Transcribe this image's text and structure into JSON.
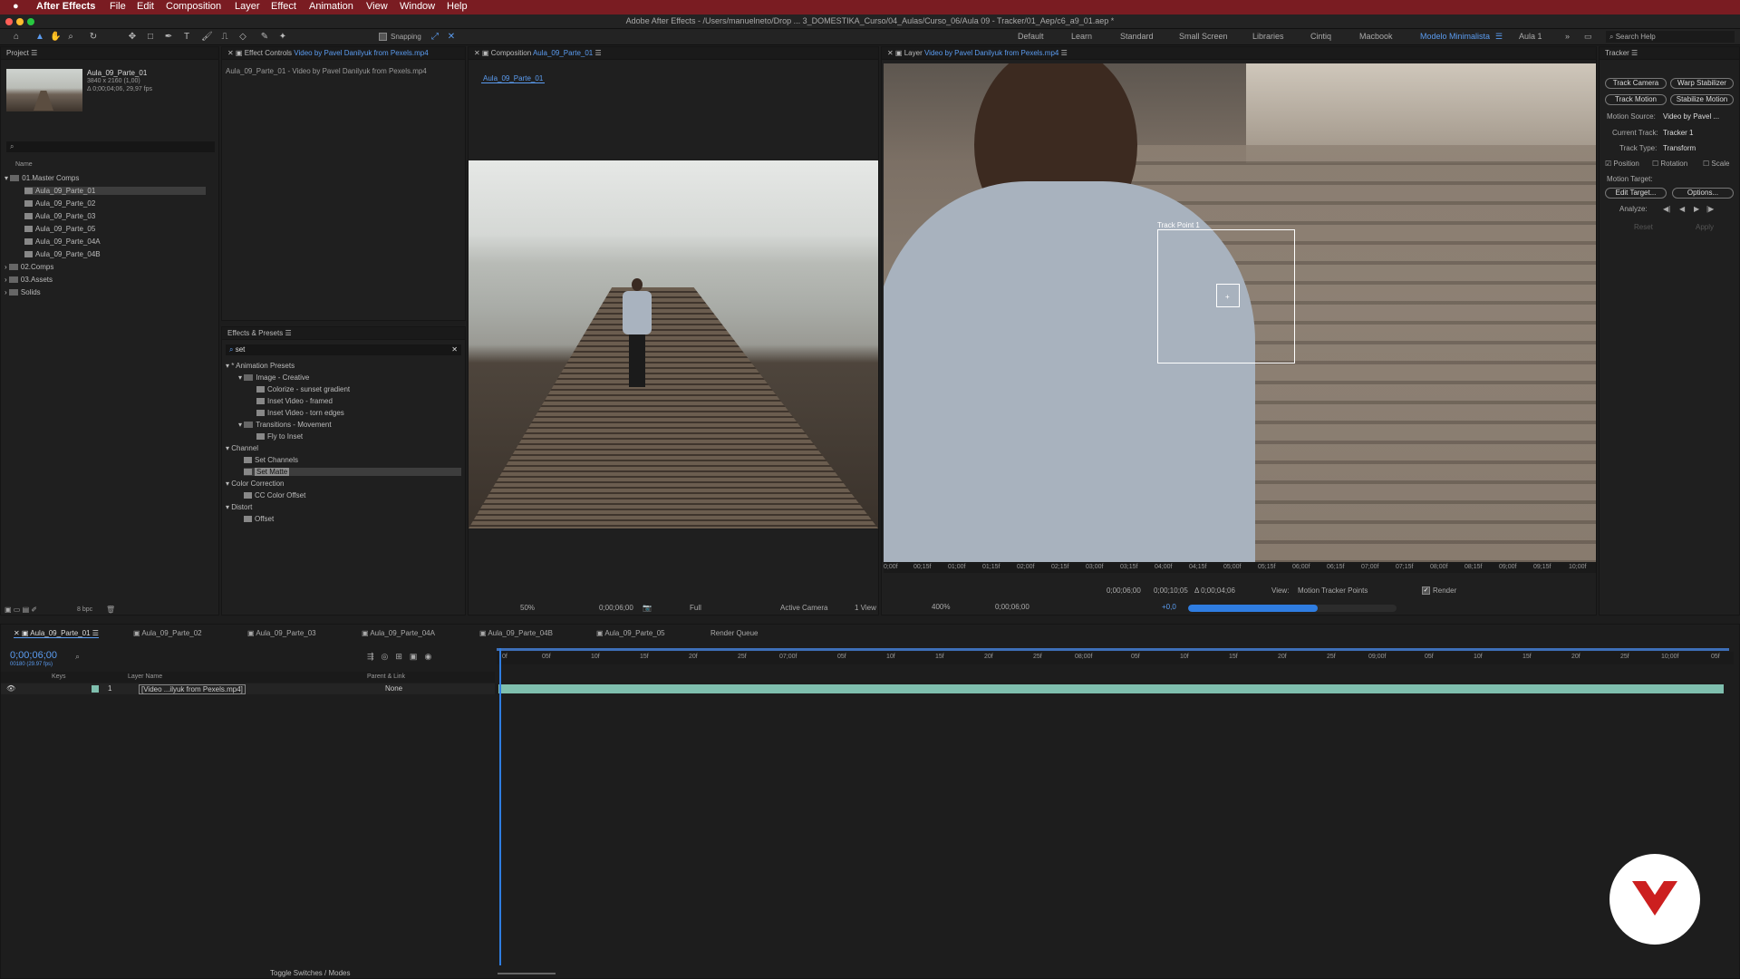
{
  "menu": {
    "app": "After Effects",
    "items": [
      "File",
      "Edit",
      "Composition",
      "Layer",
      "Effect",
      "Animation",
      "View",
      "Window",
      "Help"
    ]
  },
  "window_title": "Adobe After Effects - /Users/manuelneto/Drop ... 3_DOMESTIKA_Curso/04_Aulas/Curso_06/Aula 09 - Tracker/01_Aep/c6_a9_01.aep *",
  "toolbar": {
    "snapping_label": "Snapping",
    "workspaces": [
      "Default",
      "Learn",
      "Standard",
      "Small Screen",
      "Libraries",
      "Cintiq",
      "Macbook",
      "Modelo Minimalista",
      "Aula 1"
    ],
    "active_workspace": "Modelo Minimalista",
    "search_placeholder": "Search Help"
  },
  "project": {
    "tab": "Project",
    "thumb_name": "Aula_09_Parte_01",
    "thumb_size": "3840 x 2160 (1,00)",
    "thumb_duration": "Δ 0;00;04;06, 29,97 fps",
    "col_name": "Name",
    "items": [
      {
        "label": "01.Master Comps",
        "type": "folder",
        "open": true
      },
      {
        "label": "Aula_09_Parte_01",
        "type": "comp",
        "selected": true
      },
      {
        "label": "Aula_09_Parte_02",
        "type": "comp"
      },
      {
        "label": "Aula_09_Parte_03",
        "type": "comp"
      },
      {
        "label": "Aula_09_Parte_05",
        "type": "comp"
      },
      {
        "label": "Aula_09_Parte_04A",
        "type": "comp"
      },
      {
        "label": "Aula_09_Parte_04B",
        "type": "comp"
      },
      {
        "label": "02.Comps",
        "type": "folder"
      },
      {
        "label": "03.Assets",
        "type": "folder"
      },
      {
        "label": "Solids",
        "type": "folder"
      }
    ],
    "bpc": "8 bpc"
  },
  "effect_controls": {
    "tab_prefix": "Effect Controls",
    "tab_source": "Video by Pavel Danilyuk from Pexels.mp4",
    "subtitle": "Aula_09_Parte_01 - Video by Pavel Danilyuk from Pexels.mp4"
  },
  "effects_presets": {
    "tab": "Effects & Presets",
    "search_value": "set",
    "items": [
      {
        "label": "* Animation Presets",
        "level": 0
      },
      {
        "label": "Image - Creative",
        "level": 1
      },
      {
        "label": "Colorize - sunset gradient",
        "level": 2
      },
      {
        "label": "Inset Video - framed",
        "level": 2
      },
      {
        "label": "Inset Video - torn edges",
        "level": 2
      },
      {
        "label": "Transitions - Movement",
        "level": 1
      },
      {
        "label": "Fly to Inset",
        "level": 2
      },
      {
        "label": "Channel",
        "level": 0
      },
      {
        "label": "Set Channels",
        "level": 1
      },
      {
        "label": "Set Matte",
        "level": 1,
        "selected": true
      },
      {
        "label": "Color Correction",
        "level": 0
      },
      {
        "label": "CC Color Offset",
        "level": 1
      },
      {
        "label": "Distort",
        "level": 0
      },
      {
        "label": "Offset",
        "level": 1
      }
    ]
  },
  "composition": {
    "tab_prefix": "Composition",
    "tab_name": "Aula_09_Parte_01",
    "subtab": "Aula_09_Parte_01",
    "zoom": "50%",
    "timecode": "0;00;06;00",
    "resolution": "Full",
    "camera": "Active Camera",
    "views": "1 View"
  },
  "layer_viewer": {
    "tab_prefix": "Layer",
    "tab_source": "Video by Pavel Danilyuk from Pexels.mp4",
    "track_point_label": "Track Point 1",
    "ruler_ticks": [
      "0;00f",
      "00;15f",
      "01;00f",
      "01;15f",
      "02;00f",
      "02;15f",
      "03;00f",
      "03;15f",
      "04;00f",
      "04;15f",
      "05;00f",
      "05;15f",
      "06;00f",
      "06;15f",
      "07;00f",
      "07;15f",
      "08;00f",
      "08;15f",
      "09;00f",
      "09;15f",
      "10;00f"
    ],
    "in_time": "0;00;06;00",
    "out_time": "0;00;10;05",
    "duration": "Δ 0;00;04;06",
    "view_label": "View:",
    "view_value": "Motion Tracker Points",
    "render_label": "Render",
    "zoom": "400%",
    "timecode": "0;00;06;00",
    "exposure": "+0,0",
    "progress": 0.62
  },
  "tracker": {
    "tab": "Tracker",
    "btn_track_camera": "Track Camera",
    "btn_warp_stabilizer": "Warp Stabilizer",
    "btn_track_motion": "Track Motion",
    "btn_stabilize_motion": "Stabilize Motion",
    "motion_source_label": "Motion Source:",
    "motion_source_value": "Video by Pavel ...",
    "current_track_label": "Current Track:",
    "current_track_value": "Tracker 1",
    "track_type_label": "Track Type:",
    "track_type_value": "Transform",
    "opt_position": "Position",
    "opt_rotation": "Rotation",
    "opt_scale": "Scale",
    "motion_target_label": "Motion Target:",
    "btn_edit_target": "Edit Target...",
    "btn_options": "Options...",
    "analyze_label": "Analyze:",
    "btn_reset": "Reset",
    "btn_apply": "Apply"
  },
  "timeline": {
    "tabs": [
      "Aula_09_Parte_01",
      "Aula_09_Parte_02",
      "Aula_09_Parte_03",
      "Aula_09_Parte_04A",
      "Aula_09_Parte_04B",
      "Aula_09_Parte_05",
      "Render Queue"
    ],
    "timecode": "0;00;06;00",
    "fps": "00180 (29.97 fps)",
    "col_keys": "Keys",
    "col_layer_name": "Layer Name",
    "col_parent": "Parent & Link",
    "layer_index": "1",
    "layer_name": "[Video ...ilyuk from Pexels.mp4]",
    "layer_parent": "None",
    "ruler_ticks": [
      "0f",
      "05f",
      "10f",
      "15f",
      "20f",
      "25f",
      "07;00f",
      "05f",
      "10f",
      "15f",
      "20f",
      "25f",
      "08;00f",
      "05f",
      "10f",
      "15f",
      "20f",
      "25f",
      "09;00f",
      "05f",
      "10f",
      "15f",
      "20f",
      "25f",
      "10;00f",
      "05f"
    ],
    "toggle_label": "Toggle Switches / Modes"
  },
  "colors": {
    "menubar": "#7a1c22",
    "accent": "#5b9cf0",
    "layer_bar": "#7fbfae",
    "brand": "#cc1f1f"
  }
}
